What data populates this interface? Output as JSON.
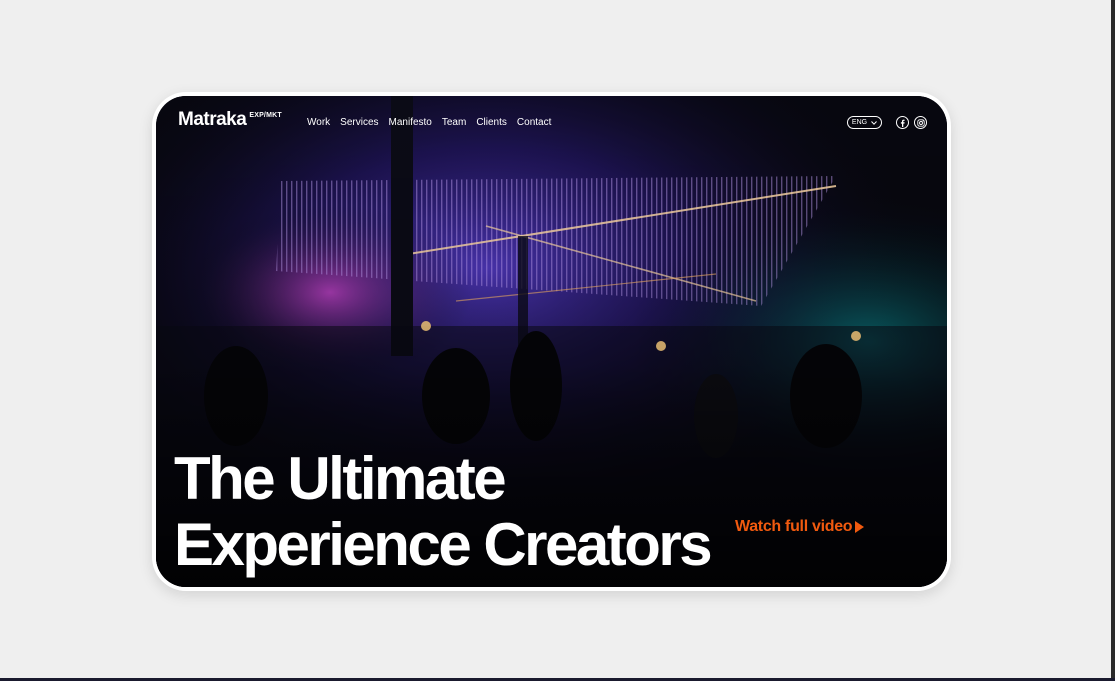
{
  "brand": {
    "name": "Matraka",
    "tagline": "EXP/MKT"
  },
  "nav": {
    "items": [
      "Work",
      "Services",
      "Manifesto",
      "Team",
      "Clients",
      "Contact"
    ]
  },
  "language": {
    "selected": "ENG"
  },
  "social": {
    "icons": [
      "facebook-icon",
      "instagram-icon"
    ]
  },
  "hero": {
    "headline_line1": "The Ultimate",
    "headline_line2": "Experience Creators",
    "cta": "Watch full video",
    "background": "event-venue-photo"
  },
  "colors": {
    "accent": "#f15a0f",
    "background": "#efefef",
    "frame": "#ffffff",
    "text": "#ffffff"
  }
}
